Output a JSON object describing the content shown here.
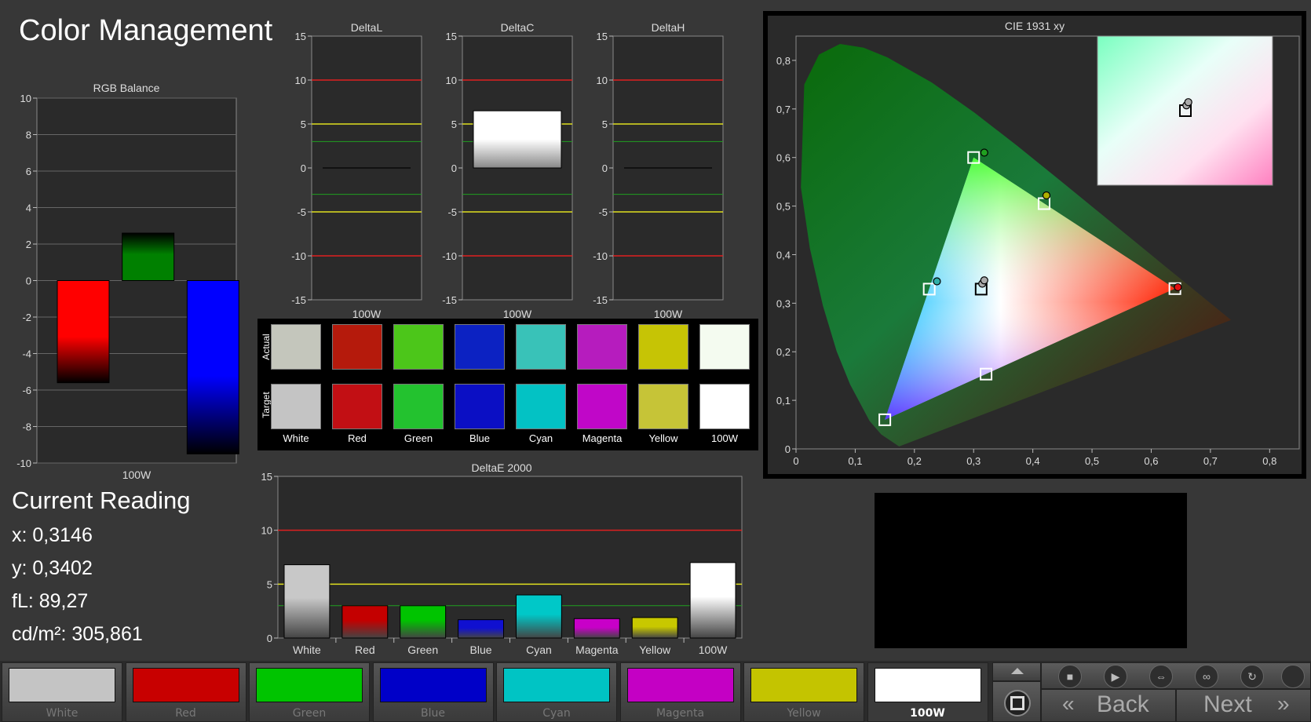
{
  "app": {
    "title": "Color Management"
  },
  "rgb_balance": {
    "chart_data": {
      "type": "bar",
      "title": "RGB Balance",
      "categories": [
        "100W"
      ],
      "series": [
        {
          "name": "Red",
          "values": [
            -5.6
          ],
          "color": "#ff0000"
        },
        {
          "name": "Green",
          "values": [
            2.6
          ],
          "color": "#008000"
        },
        {
          "name": "Blue",
          "values": [
            -9.5
          ],
          "color": "#0000ff"
        }
      ],
      "ylim": [
        -10,
        10
      ],
      "yticks": [
        "10",
        "8",
        "6",
        "4",
        "2",
        "0",
        "-2",
        "-4",
        "-6",
        "-8",
        "-10"
      ]
    }
  },
  "delta_charts": [
    {
      "chart_data": {
        "type": "bar",
        "title": "DeltaL",
        "categories": [
          "100W"
        ],
        "values": [
          0
        ],
        "ylim": [
          -15,
          15
        ],
        "yticks": [
          "15",
          "10",
          "5",
          "0",
          "-5",
          "-10",
          "-15"
        ]
      }
    },
    {
      "chart_data": {
        "type": "bar",
        "title": "DeltaC",
        "categories": [
          "100W"
        ],
        "values": [
          6.5
        ],
        "ylim": [
          -15,
          15
        ],
        "yticks": [
          "15",
          "10",
          "5",
          "0",
          "-5",
          "-10",
          "-15"
        ]
      }
    },
    {
      "chart_data": {
        "type": "bar",
        "title": "DeltaH",
        "categories": [
          "100W"
        ],
        "values": [
          0
        ],
        "ylim": [
          -15,
          15
        ],
        "yticks": [
          "15",
          "10",
          "5",
          "0",
          "-5",
          "-10",
          "-15"
        ]
      }
    }
  ],
  "threshold_lines": {
    "red": 10,
    "yellow": 5,
    "green": 3
  },
  "swatch_grid": {
    "row_labels": {
      "actual": "Actual",
      "target": "Target"
    },
    "items": [
      {
        "name": "White",
        "actual": "#c4c6bc",
        "target": "#c4c4c4"
      },
      {
        "name": "Red",
        "actual": "#b51a0c",
        "target": "#c20f14"
      },
      {
        "name": "Green",
        "actual": "#4cc61a",
        "target": "#23c22f"
      },
      {
        "name": "Blue",
        "actual": "#0c22c2",
        "target": "#0b0fc4"
      },
      {
        "name": "Cyan",
        "actual": "#39c2b8",
        "target": "#03c2c4"
      },
      {
        "name": "Magenta",
        "actual": "#b61cbe",
        "target": "#c007c8"
      },
      {
        "name": "Yellow",
        "actual": "#c6c405",
        "target": "#c6c437"
      },
      {
        "name": "100W",
        "actual": "#f4fbf0",
        "target": "#ffffff"
      }
    ]
  },
  "deltae": {
    "chart_data": {
      "type": "bar",
      "title": "DeltaE 2000",
      "categories": [
        "White",
        "Red",
        "Green",
        "Blue",
        "Cyan",
        "Magenta",
        "Yellow",
        "100W"
      ],
      "values": [
        6.8,
        3.0,
        3.0,
        1.7,
        4.0,
        1.8,
        1.9,
        7.0
      ],
      "colors": [
        "#c8c8c8",
        "#c40000",
        "#00c400",
        "#1010d0",
        "#00c8c8",
        "#c800c8",
        "#c8c800",
        "#ffffff"
      ],
      "ylim": [
        0,
        15
      ],
      "yticks": [
        "15",
        "10",
        "5",
        "0"
      ]
    }
  },
  "cie": {
    "chart_data": {
      "type": "scatter",
      "title": "CIE 1931 xy",
      "xlim": [
        0,
        0.85
      ],
      "ylim": [
        0,
        0.85
      ],
      "xticks": [
        "0",
        "0,1",
        "0,2",
        "0,3",
        "0,4",
        "0,5",
        "0,6",
        "0,7",
        "0,8"
      ],
      "yticks": [
        "0,8",
        "0,7",
        "0,6",
        "0,5",
        "0,4",
        "0,3",
        "0,2",
        "0,1",
        "0"
      ],
      "gamut_triangle": [
        [
          0.64,
          0.33
        ],
        [
          0.3,
          0.6
        ],
        [
          0.15,
          0.06
        ]
      ],
      "targets": [
        {
          "name": "Red",
          "x": 0.64,
          "y": 0.33
        },
        {
          "name": "Green",
          "x": 0.3,
          "y": 0.6
        },
        {
          "name": "Blue",
          "x": 0.15,
          "y": 0.06
        },
        {
          "name": "Cyan",
          "x": 0.225,
          "y": 0.329
        },
        {
          "name": "Magenta",
          "x": 0.321,
          "y": 0.154
        },
        {
          "name": "Yellow",
          "x": 0.419,
          "y": 0.505
        },
        {
          "name": "White",
          "x": 0.3127,
          "y": 0.329
        }
      ],
      "measured": [
        {
          "name": "Red",
          "x": 0.645,
          "y": 0.333,
          "color": "#e01010"
        },
        {
          "name": "Green",
          "x": 0.318,
          "y": 0.61,
          "color": "#20a020"
        },
        {
          "name": "Cyan",
          "x": 0.238,
          "y": 0.345,
          "color": "#30b0a8"
        },
        {
          "name": "Yellow",
          "x": 0.423,
          "y": 0.522,
          "color": "#b0b000"
        },
        {
          "name": "White",
          "x": 0.3146,
          "y": 0.3402,
          "color": "#aaaaaa"
        },
        {
          "name": "100W",
          "x": 0.318,
          "y": 0.347,
          "color": "#aaaaaa"
        }
      ],
      "inset": {
        "target": [
          0.3127,
          0.329
        ],
        "measured": [
          [
            0.3146,
            0.3402
          ],
          [
            0.318,
            0.347
          ]
        ]
      }
    }
  },
  "current_reading": {
    "title": "Current Reading",
    "x": "x: 0,3146",
    "y": "y: 0,3402",
    "fl": "fL: 89,27",
    "cdm2": "cd/m²: 305,861"
  },
  "bottom_swatches": [
    {
      "label": "White",
      "color": "#c4c4c4",
      "selected": false
    },
    {
      "label": "Red",
      "color": "#c80000",
      "selected": false
    },
    {
      "label": "Green",
      "color": "#00c400",
      "selected": false
    },
    {
      "label": "Blue",
      "color": "#0000c8",
      "selected": false
    },
    {
      "label": "Cyan",
      "color": "#00c4c4",
      "selected": false
    },
    {
      "label": "Magenta",
      "color": "#c400c4",
      "selected": false
    },
    {
      "label": "Yellow",
      "color": "#c4c400",
      "selected": false
    },
    {
      "label": "100W",
      "color": "#ffffff",
      "selected": true
    }
  ],
  "controls": {
    "back_label": "Back",
    "next_label": "Next",
    "icons": [
      "up-arrow-icon",
      "stop-icon",
      "play-icon",
      "fit-width-icon",
      "infinity-icon",
      "refresh-icon",
      "circle-icon",
      "square-stop-icon"
    ]
  }
}
